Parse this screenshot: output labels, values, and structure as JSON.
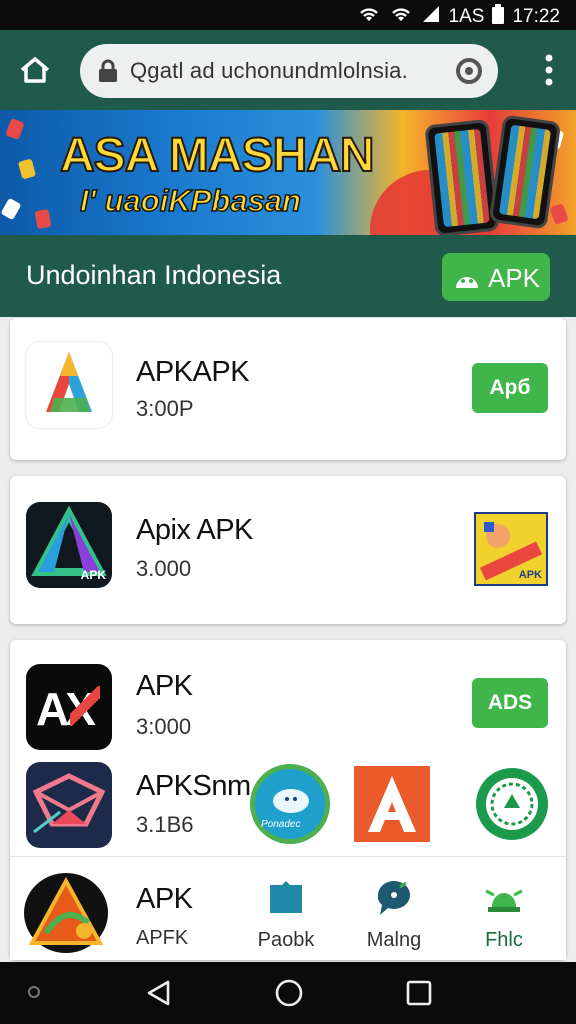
{
  "status_bar": {
    "carrier_text": "1AS",
    "time": "17:22",
    "icons": [
      "wifi-icon",
      "wifi-icon",
      "signal-icon",
      "battery-icon"
    ]
  },
  "browser": {
    "url_text": "Qgatl ad uchonundmlolnsia.",
    "icons": [
      "home-icon",
      "lock-icon",
      "location-icon",
      "more-vert-icon"
    ]
  },
  "banner": {
    "title": "ASA MASHAN",
    "subtitle": "I' uaoiKPbasan"
  },
  "header": {
    "title": "Undoinhan Indonesia",
    "button_label": "APK",
    "button_color": "#3fb54a",
    "bg_color": "#1f5a4a"
  },
  "apps": [
    {
      "name": "APKAPK",
      "size": "3:00P",
      "button": "Apб"
    },
    {
      "name": "Apix APK",
      "size": "3.000",
      "thumb_text": "APK"
    },
    {
      "name": "APK",
      "size": "3:000",
      "button": "ADS"
    },
    {
      "name": "APKSnm",
      "size": "3.1B6"
    },
    {
      "name": "APK",
      "size": "APFK"
    }
  ],
  "icon_labels": {
    "app2_icon_text": "APK",
    "ax_icon_text": "AX"
  },
  "floating_icon_text": "Ponadec",
  "bottom_nav": {
    "items": [
      {
        "label": "Paobk"
      },
      {
        "label": "Malng"
      },
      {
        "label": "Fhlc"
      }
    ]
  }
}
